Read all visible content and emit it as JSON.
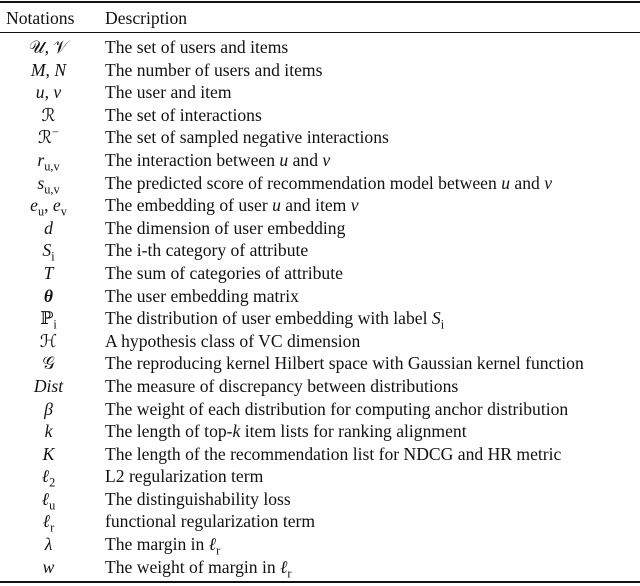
{
  "table": {
    "headers": {
      "notation": "Notations",
      "description": "Description"
    },
    "rows": [
      {
        "notation": [
          {
            "t": "𝒰, 𝒱"
          }
        ],
        "description": [
          {
            "t": "The set of users and items"
          }
        ]
      },
      {
        "notation": [
          {
            "t": "M",
            "i": true
          },
          {
            "t": ", "
          },
          {
            "t": "N",
            "i": true
          }
        ],
        "description": [
          {
            "t": "The number of users and items"
          }
        ]
      },
      {
        "notation": [
          {
            "t": "u",
            "i": true
          },
          {
            "t": ", "
          },
          {
            "t": "v",
            "i": true
          }
        ],
        "description": [
          {
            "t": "The user and item"
          }
        ]
      },
      {
        "notation": [
          {
            "t": "ℛ"
          }
        ],
        "description": [
          {
            "t": "The set of interactions"
          }
        ]
      },
      {
        "notation": [
          {
            "t": "ℛ"
          },
          {
            "t": "−",
            "sup": true
          }
        ],
        "description": [
          {
            "t": "The set of sampled negative interactions"
          }
        ]
      },
      {
        "notation": [
          {
            "t": "r",
            "i": true
          },
          {
            "t": "u,v",
            "sub": true
          }
        ],
        "description": [
          {
            "t": "The interaction between "
          },
          {
            "t": "u",
            "i": true
          },
          {
            "t": " and "
          },
          {
            "t": "v",
            "i": true
          }
        ]
      },
      {
        "notation": [
          {
            "t": "s",
            "i": true
          },
          {
            "t": "u,v",
            "sub": true
          }
        ],
        "description": [
          {
            "t": "The predicted score of recommendation model between "
          },
          {
            "t": "u",
            "i": true
          },
          {
            "t": " and "
          },
          {
            "t": "v",
            "i": true
          }
        ]
      },
      {
        "notation": [
          {
            "t": "e",
            "i": true
          },
          {
            "t": "u",
            "sub": true
          },
          {
            "t": ", "
          },
          {
            "t": "e",
            "i": true
          },
          {
            "t": "v",
            "sub": true
          }
        ],
        "description": [
          {
            "t": "The embedding of user "
          },
          {
            "t": "u",
            "i": true
          },
          {
            "t": " and item "
          },
          {
            "t": "v",
            "i": true
          }
        ]
      },
      {
        "notation": [
          {
            "t": "d",
            "i": true
          }
        ],
        "description": [
          {
            "t": "The dimension of user embedding"
          }
        ]
      },
      {
        "notation": [
          {
            "t": "S",
            "i": true
          },
          {
            "t": "i",
            "sub": true
          }
        ],
        "description": [
          {
            "t": "The i-th category of attribute"
          }
        ]
      },
      {
        "notation": [
          {
            "t": "T",
            "i": true
          }
        ],
        "description": [
          {
            "t": "The sum of categories of attribute"
          }
        ]
      },
      {
        "notation": [
          {
            "t": "θ",
            "i": true,
            "b": true
          }
        ],
        "description": [
          {
            "t": "The user embedding matrix"
          }
        ]
      },
      {
        "notation": [
          {
            "t": "ℙ"
          },
          {
            "t": "i",
            "sub": true
          }
        ],
        "description": [
          {
            "t": "The distribution of user embedding with label "
          },
          {
            "t": "S",
            "i": true
          },
          {
            "t": "i",
            "sub": true
          }
        ]
      },
      {
        "notation": [
          {
            "t": "ℋ"
          }
        ],
        "description": [
          {
            "t": "A hypothesis class of VC dimension"
          }
        ]
      },
      {
        "notation": [
          {
            "t": "𝒢"
          }
        ],
        "description": [
          {
            "t": "The reproducing kernel Hilbert space with Gaussian kernel function"
          }
        ]
      },
      {
        "notation": [
          {
            "t": "Dist",
            "i": true
          }
        ],
        "description": [
          {
            "t": "The measure of discrepancy between distributions"
          }
        ]
      },
      {
        "notation": [
          {
            "t": "β",
            "i": true
          }
        ],
        "description": [
          {
            "t": "The weight of each distribution for computing anchor distribution"
          }
        ]
      },
      {
        "notation": [
          {
            "t": "k",
            "i": true
          }
        ],
        "description": [
          {
            "t": "The length of top-"
          },
          {
            "t": "k",
            "i": true
          },
          {
            "t": " item lists for ranking alignment"
          }
        ]
      },
      {
        "notation": [
          {
            "t": "K",
            "i": true
          }
        ],
        "description": [
          {
            "t": "The length of the recommendation list for NDCG and HR metric"
          }
        ]
      },
      {
        "notation": [
          {
            "t": "ℓ",
            "i": true
          },
          {
            "t": "2",
            "sub": true
          }
        ],
        "description": [
          {
            "t": "L2 regularization term"
          }
        ]
      },
      {
        "notation": [
          {
            "t": "ℓ",
            "i": true
          },
          {
            "t": "u",
            "sub": true
          }
        ],
        "description": [
          {
            "t": "The distinguishability loss"
          }
        ]
      },
      {
        "notation": [
          {
            "t": "ℓ",
            "i": true
          },
          {
            "t": "r",
            "sub": true
          }
        ],
        "description": [
          {
            "t": "functional regularization term"
          }
        ]
      },
      {
        "notation": [
          {
            "t": "λ",
            "i": true
          }
        ],
        "description": [
          {
            "t": "The margin in "
          },
          {
            "t": "ℓ",
            "i": true
          },
          {
            "t": "r",
            "sub": true
          }
        ]
      },
      {
        "notation": [
          {
            "t": "w",
            "i": true
          }
        ],
        "description": [
          {
            "t": "The weight of margin in "
          },
          {
            "t": "ℓ",
            "i": true
          },
          {
            "t": "r",
            "sub": true
          }
        ]
      }
    ]
  }
}
